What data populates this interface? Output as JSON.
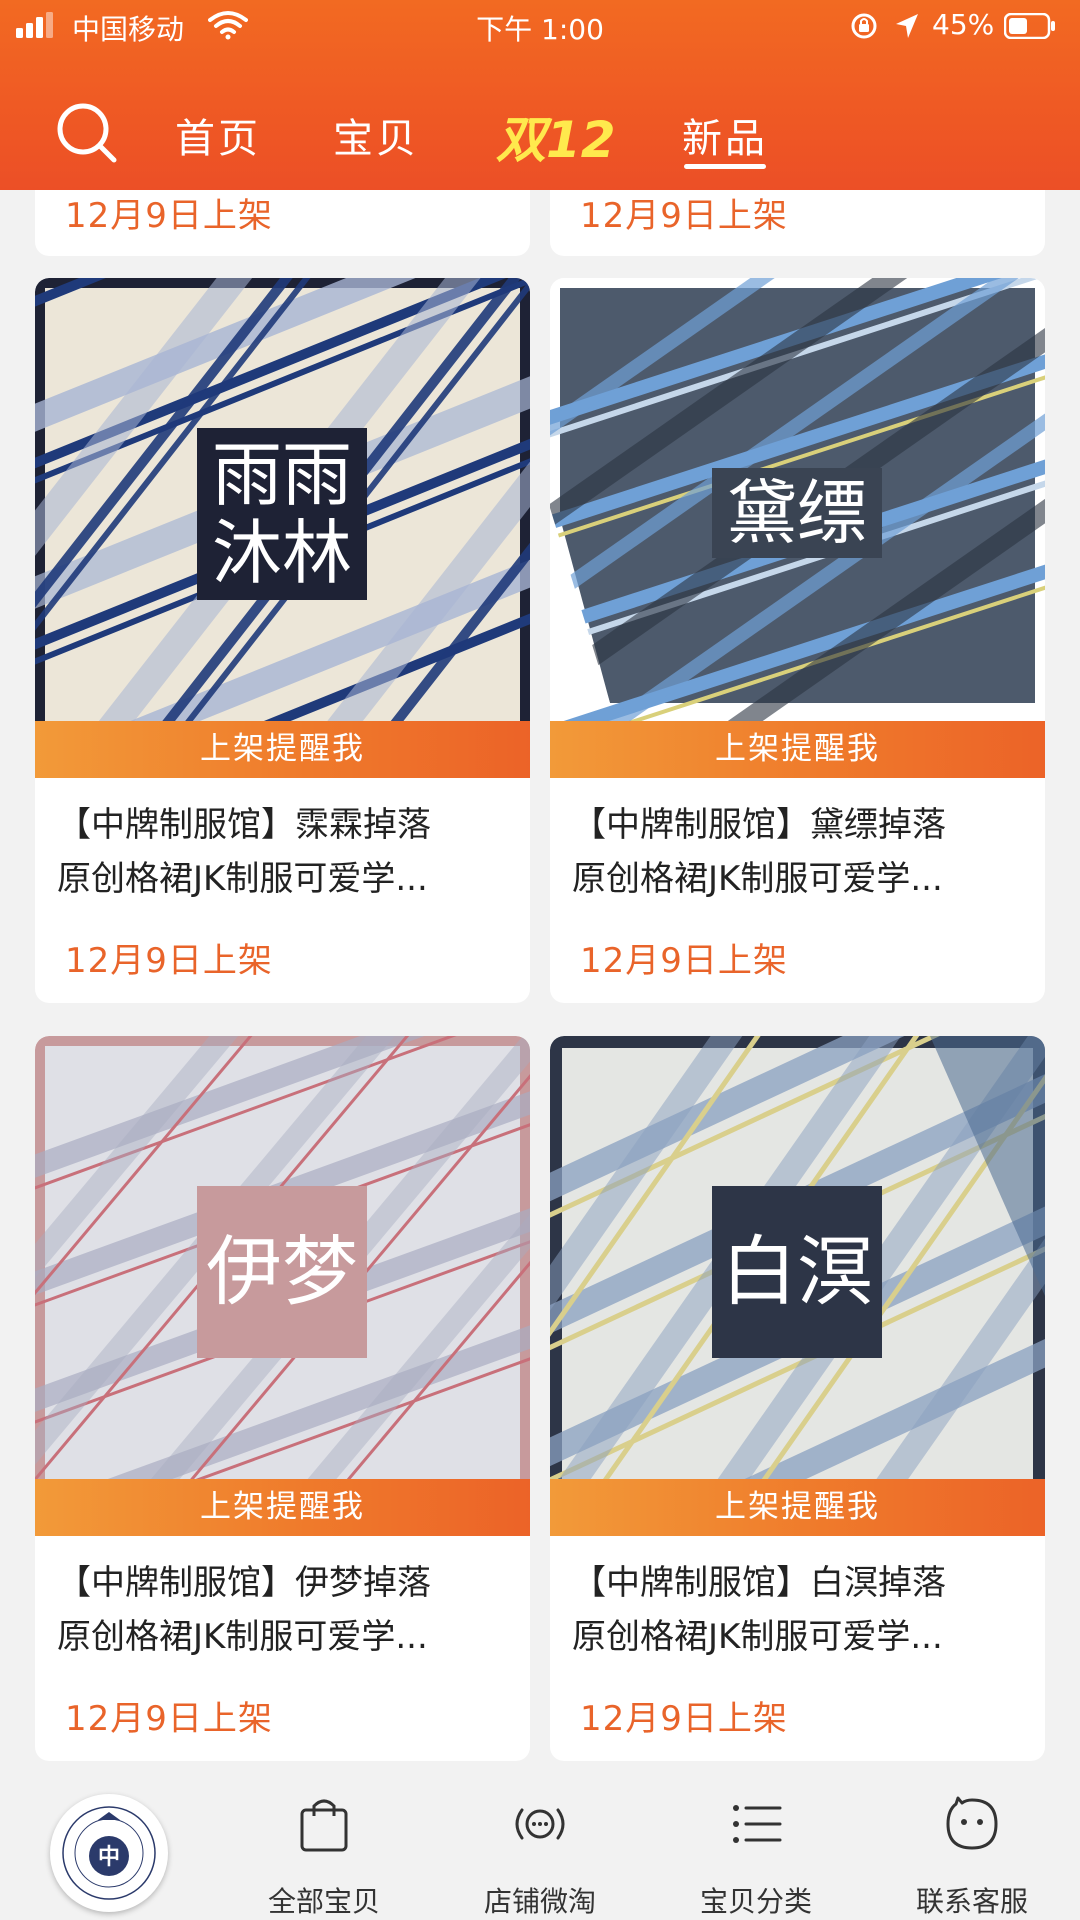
{
  "status_bar": {
    "carrier": "中国移动",
    "time": "下午 1:00",
    "battery": "45%"
  },
  "nav": {
    "tabs": [
      "首页",
      "宝贝",
      "双12",
      "新品"
    ],
    "active_tab": "新品"
  },
  "partial_cards": [
    {
      "date": "12月9日上架"
    },
    {
      "date": "12月9日上架"
    }
  ],
  "products": [
    {
      "name_char_line1": "霂霖",
      "name_char_line2": "",
      "name_display": [
        "雨雨",
        "沐林"
      ],
      "remind": "上架提醒我",
      "title_line1": "【中牌制服馆】霂霖掉落",
      "title_line2": "原创格裙JK制服可爱学...",
      "date": "12月9日上架",
      "theme": "navy-cream",
      "colors": {
        "base": "#e9e4d9",
        "stripe1": "#1f3a7a",
        "stripe2": "#9aa9cc",
        "frame": "#1e2235",
        "box": "#1e2235"
      }
    },
    {
      "name_display": [
        "黛缥"
      ],
      "remind": "上架提醒我",
      "title_line1": "【中牌制服馆】黛缥掉落",
      "title_line2": "原创格裙JK制服可爱学...",
      "date": "12月9日上架",
      "theme": "slate-blue",
      "colors": {
        "base": "#4d5a6c",
        "stripe1": "#6fa0d6",
        "stripe2": "#2b3441",
        "frame": "#ffffff",
        "box": "#3a4453"
      }
    },
    {
      "name_display": [
        "伊梦"
      ],
      "remind": "上架提醒我",
      "title_line1": "【中牌制服馆】伊梦掉落",
      "title_line2": "原创格裙JK制服可爱学...",
      "date": "12月9日上架",
      "theme": "pink-grey",
      "colors": {
        "base": "#dcdde3",
        "stripe1": "#9a9fb8",
        "stripe2": "#c8707a",
        "frame": "#c79a9c",
        "box": "#c79a9c"
      }
    },
    {
      "name_display": [
        "白溟"
      ],
      "remind": "上架提醒我",
      "title_line1": "【中牌制服馆】白溟掉落",
      "title_line2": "原创格裙JK制服可爱学...",
      "date": "12月9日上架",
      "theme": "pale-blue",
      "colors": {
        "base": "#e6e8e6",
        "stripe1": "#7d93b5",
        "stripe2": "#d9cf8c",
        "frame": "#2d3547",
        "box": "#2d3547"
      }
    }
  ],
  "bottom_bar": {
    "logo_char": "中",
    "items": [
      {
        "label": "全部宝贝",
        "icon": "shopping-bag-icon"
      },
      {
        "label": "店铺微淘",
        "icon": "broadcast-icon"
      },
      {
        "label": "宝贝分类",
        "icon": "list-icon"
      },
      {
        "label": "联系客服",
        "icon": "chat-face-icon"
      }
    ]
  },
  "accent_color": "#ef5a24"
}
